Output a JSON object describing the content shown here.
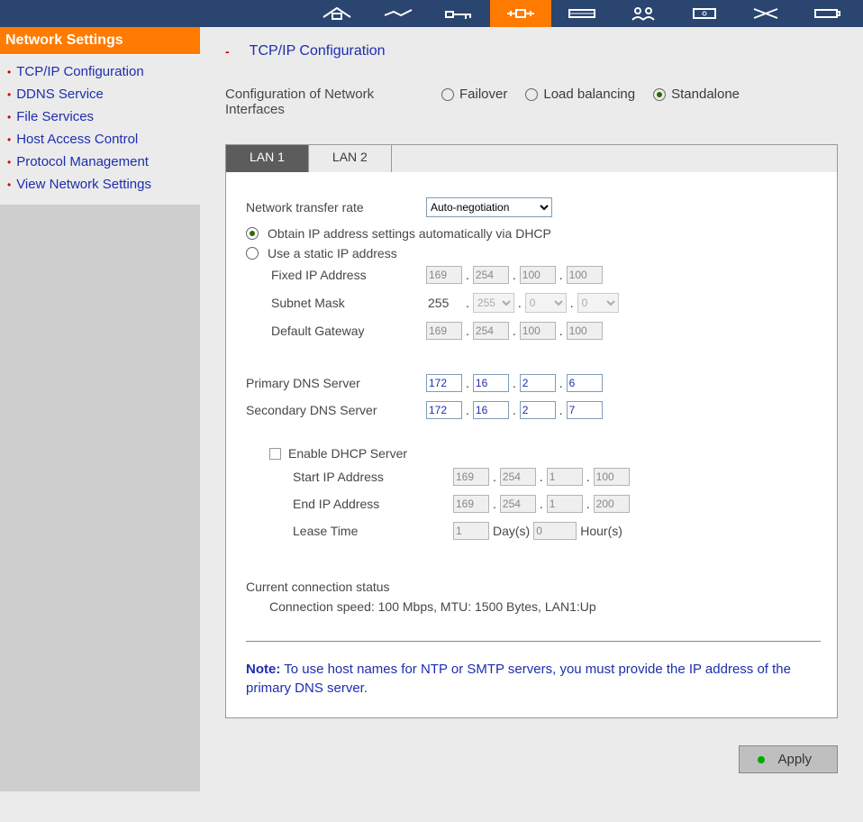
{
  "sidebar": {
    "header": "Network Settings",
    "items": [
      {
        "label": "TCP/IP Configuration"
      },
      {
        "label": "DDNS Service"
      },
      {
        "label": "File Services"
      },
      {
        "label": "Host Access Control"
      },
      {
        "label": "Protocol Management"
      },
      {
        "label": "View Network Settings"
      }
    ]
  },
  "page": {
    "title": "TCP/IP Configuration",
    "config_label": "Configuration of Network Interfaces",
    "modes": {
      "failover": "Failover",
      "load": "Load balancing",
      "standalone": "Standalone"
    },
    "tabs": {
      "lan1": "LAN 1",
      "lan2": "LAN 2"
    },
    "transfer_rate_label": "Network transfer rate",
    "transfer_rate_value": "Auto-negotiation",
    "ip_mode": {
      "dhcp": "Obtain IP address settings automatically via DHCP",
      "static": "Use a static IP address"
    },
    "fixed_ip_label": "Fixed IP Address",
    "fixed_ip": [
      "169",
      "254",
      "100",
      "100"
    ],
    "subnet_label": "Subnet Mask",
    "subnet_fixed": "255",
    "subnet": [
      "255",
      "0",
      "0"
    ],
    "gateway_label": "Default Gateway",
    "gateway": [
      "169",
      "254",
      "100",
      "100"
    ],
    "dns1_label": "Primary DNS Server",
    "dns1": [
      "172",
      "16",
      "2",
      "6"
    ],
    "dns2_label": "Secondary DNS Server",
    "dns2": [
      "172",
      "16",
      "2",
      "7"
    ],
    "dhcp_server": {
      "enable_label": "Enable DHCP Server",
      "start_label": "Start IP Address",
      "start": [
        "169",
        "254",
        "1",
        "100"
      ],
      "end_label": "End IP Address",
      "end": [
        "169",
        "254",
        "1",
        "200"
      ],
      "lease_label": "Lease Time",
      "lease_days": "1",
      "days_unit": "Day(s)",
      "lease_hours": "0",
      "hours_unit": "Hour(s)"
    },
    "status_title": "Current connection status",
    "status_text": "Connection speed: 100 Mbps, MTU: 1500 Bytes, LAN1:Up",
    "note_label": "Note:",
    "note_text": " To use host names for NTP or SMTP servers, you must provide the IP address of the primary DNS server.",
    "apply": "Apply"
  }
}
